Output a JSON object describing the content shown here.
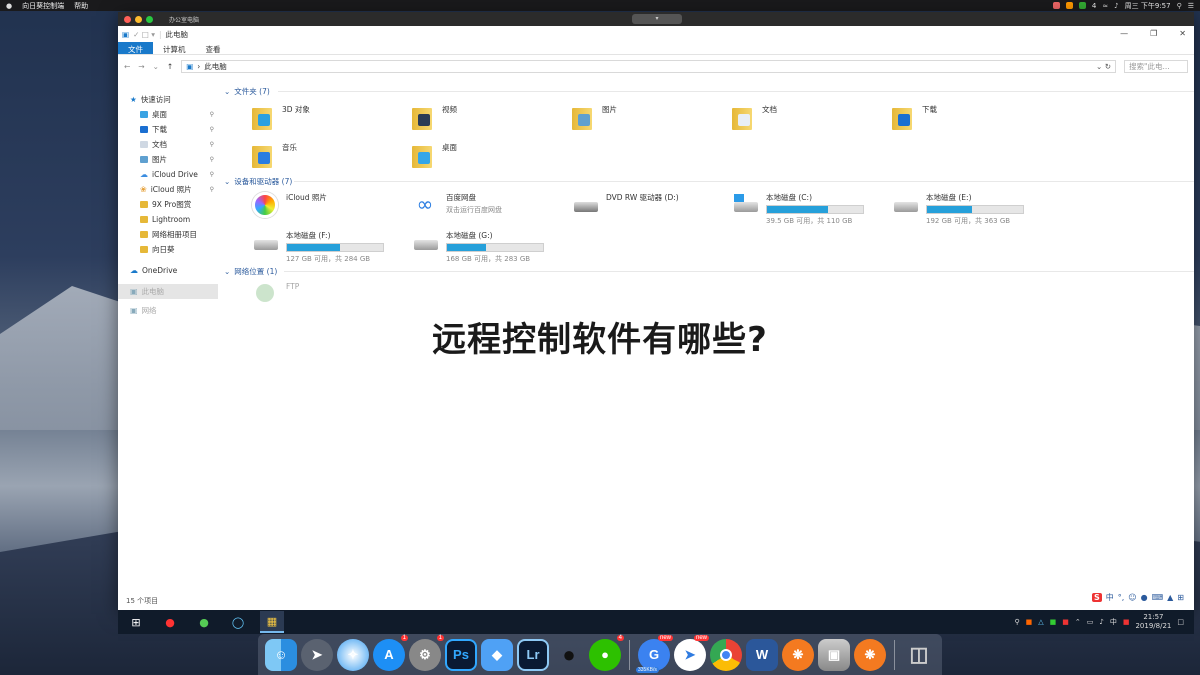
{
  "mac_menubar": {
    "app_name": "向日葵控制端",
    "menu_help": "帮助",
    "status_text": "4",
    "clock": "周三 下午9:57"
  },
  "mac_window": {
    "title": "办公室电脑"
  },
  "explorer": {
    "window_title": "此电脑",
    "ribbon_tabs": [
      {
        "label": "文件",
        "active": true
      },
      {
        "label": "计算机",
        "active": false
      },
      {
        "label": "查看",
        "active": false
      }
    ],
    "address_path": "此电脑",
    "search_placeholder": "搜索\"此电...",
    "nav": {
      "quick_access": "快速访问",
      "items": [
        "桌面",
        "下载",
        "文档",
        "图片",
        "iCloud Drive",
        "iCloud 照片",
        "9X Pro图赏",
        "Lightroom",
        "网络相册项目",
        "向日葵"
      ],
      "onedrive": "OneDrive",
      "this_pc": "此电脑",
      "network": "网络"
    },
    "folders_header": "文件夹 (7)",
    "folders": [
      {
        "name": "3D 对象",
        "overlay": "#2aa0e0"
      },
      {
        "name": "视频",
        "overlay": "#2a3b55"
      },
      {
        "name": "图片",
        "overlay": "#5fa0d0"
      },
      {
        "name": "文档",
        "overlay": "#e8eef5"
      },
      {
        "name": "下载",
        "overlay": "#1b6fd1"
      },
      {
        "name": "音乐",
        "overlay": "#2a7de1"
      },
      {
        "name": "桌面",
        "overlay": "#34a6e8"
      }
    ],
    "devices_header": "设备和驱动器 (7)",
    "icloud_photos": "iCloud 照片",
    "baidu": {
      "name": "百度网盘",
      "sub": "双击运行百度网盘"
    },
    "dvd": "DVD RW 驱动器 (D:)",
    "drives": [
      {
        "name": "本地磁盘 (C:)",
        "free": "39.5 GB 可用，共 110 GB",
        "used_fraction": 0.64
      },
      {
        "name": "本地磁盘 (E:)",
        "free": "192 GB 可用，共 363 GB",
        "used_fraction": 0.47
      },
      {
        "name": "本地磁盘 (F:)",
        "free": "127 GB 可用，共 284 GB",
        "used_fraction": 0.55
      },
      {
        "name": "本地磁盘 (G:)",
        "free": "168 GB 可用，共 283 GB",
        "used_fraction": 0.41
      }
    ],
    "network_header": "网络位置 (1)",
    "ftp": "FTP",
    "status_bar": "15 个项目"
  },
  "taskbar": {
    "ime_lang": "中",
    "time": "21:57",
    "date": "2019/8/21"
  },
  "overlay_title": "远程控制软件有哪些?",
  "dock": {
    "photoshop": "Ps",
    "lightroom": "Lr",
    "word": "W",
    "badge_appstore": "1",
    "badge_prefs": "1",
    "badge_wechat": "4",
    "badge_new1": "new",
    "badge_new2": "new",
    "speed": "335KB/s"
  }
}
